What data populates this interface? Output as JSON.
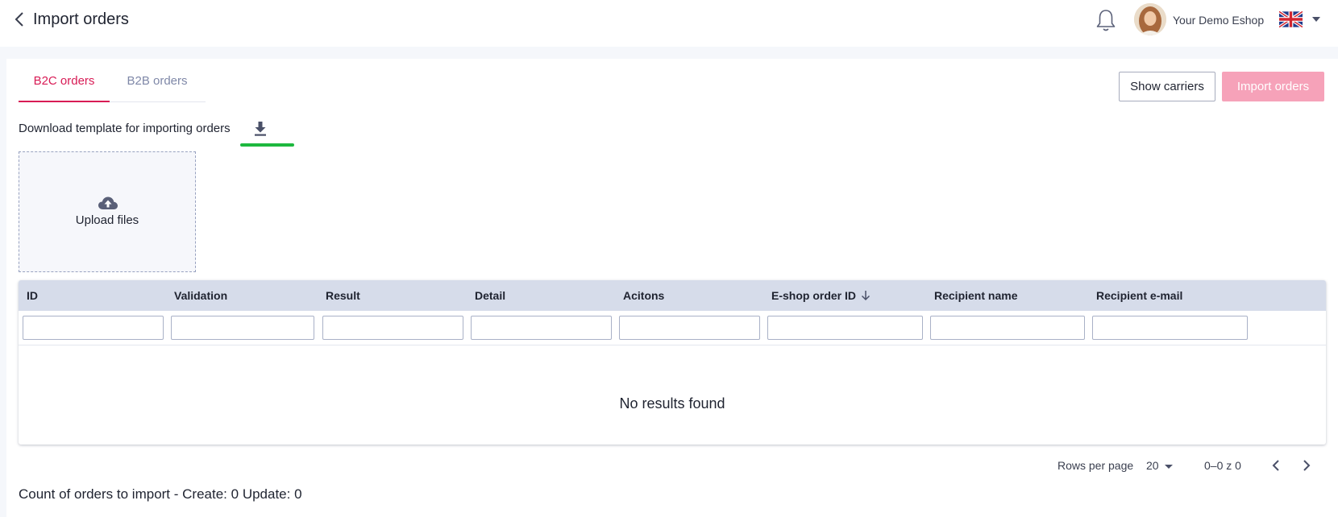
{
  "header": {
    "title": "Import orders",
    "shop_name": "Your Demo Eshop",
    "icons": [
      "chevron-left-icon",
      "bell-icon",
      "avatar",
      "uk-flag-icon",
      "caret-down-icon"
    ]
  },
  "tabs": [
    {
      "label": "B2C orders",
      "active": true
    },
    {
      "label": "B2B orders",
      "active": false
    }
  ],
  "actions": {
    "show_carriers": "Show carriers",
    "import_orders": "Import orders"
  },
  "download": {
    "text": "Download template for importing orders",
    "icon": "download-icon"
  },
  "upload": {
    "label": "Upload files",
    "icon": "cloud-upload-icon"
  },
  "table": {
    "columns": [
      "ID",
      "Validation",
      "Result",
      "Detail",
      "Acitons",
      "E-shop order ID",
      "Recipient name",
      "Recipient e-mail"
    ],
    "sorted_column": "E-shop order ID",
    "sort_direction": "descending",
    "empty_text": "No results found"
  },
  "pagination": {
    "rows_label": "Rows per page",
    "rows_value": "20",
    "range": "0–0 z 0"
  },
  "summary": {
    "prefix": "Count of orders to import - ",
    "create_label": "Create: ",
    "create_value": "0",
    "update_label": " Update: ",
    "update_value": "0"
  },
  "colors": {
    "accent": "#d81b55",
    "import_button": "#f6a2b9",
    "table_header": "#d6dcea",
    "highlight_underline": "#1db83e",
    "page_background": "#f5f7fb"
  }
}
